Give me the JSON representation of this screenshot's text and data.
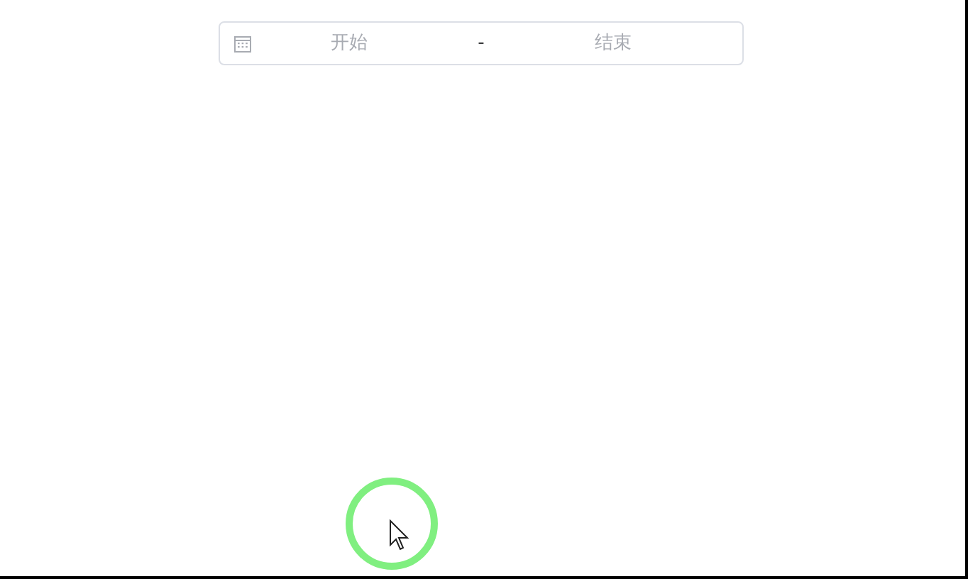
{
  "date_range": {
    "start": {
      "placeholder": "开始"
    },
    "separator": "-",
    "end": {
      "placeholder": "结束"
    }
  }
}
